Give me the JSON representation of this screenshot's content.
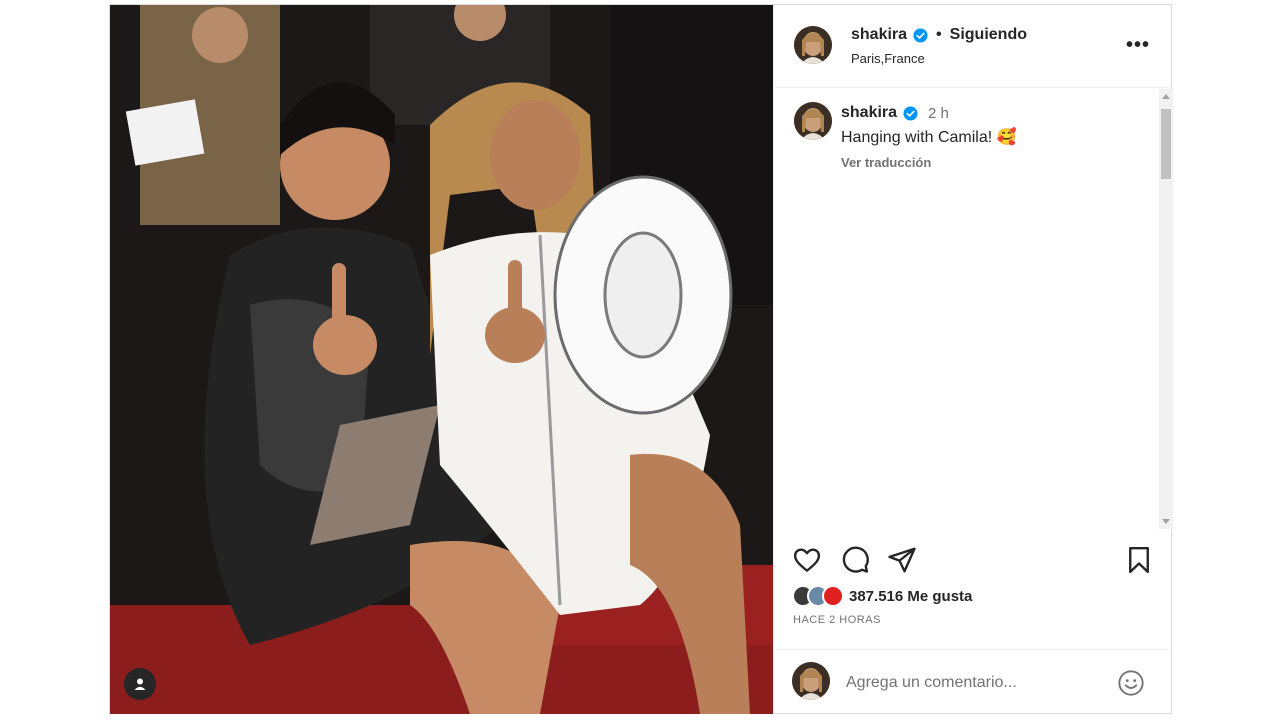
{
  "post": {
    "image_alt": "Two women seated at a fashion show front row",
    "tag_icon": "user-tag-icon"
  },
  "header": {
    "username": "shakira",
    "separator": "•",
    "follow_label": "Siguiendo",
    "location": "Paris,France",
    "more_icon": "more-options-icon",
    "more_label": "•••"
  },
  "caption": {
    "username": "shakira",
    "time": "2 h",
    "text": "Hanging with Camila! 🥰",
    "translate_label": "Ver traducción"
  },
  "actions": {
    "like_icon": "heart-icon",
    "comment_icon": "comment-icon",
    "share_icon": "share-icon",
    "save_icon": "bookmark-icon"
  },
  "likes": {
    "count_text": "387.516 Me gusta"
  },
  "timestamp": "HACE 2 HORAS",
  "comment_box": {
    "placeholder": "Agrega un comentario...",
    "emoji_icon": "emoji-icon"
  },
  "colors": {
    "verified": "#0095f6",
    "text": "#262626",
    "muted": "#737373",
    "border": "#dbdbdb"
  }
}
